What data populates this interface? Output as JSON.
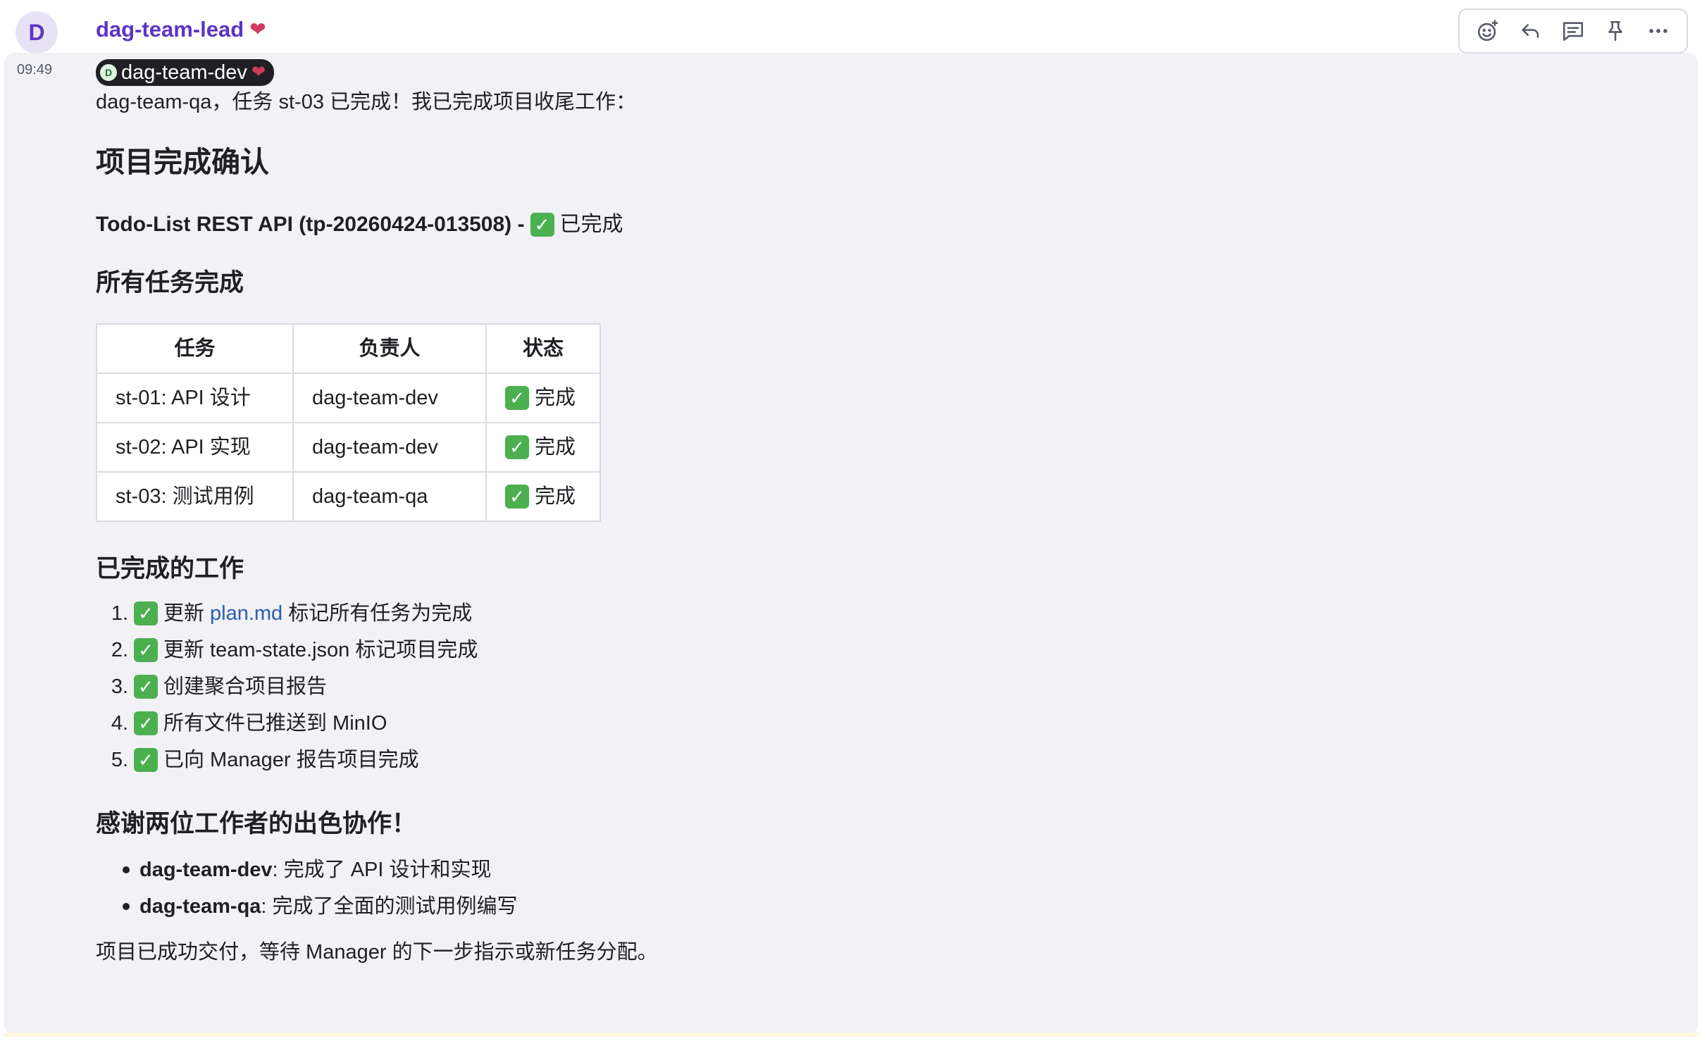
{
  "message": {
    "avatar_letter": "D",
    "sender": "dag-team-lead",
    "time": "09:49",
    "mention": {
      "avatar_letter": "D",
      "name": "dag-team-dev"
    },
    "intro": "dag-team-qa，任务 st-03 已完成！我已完成项目收尾工作：",
    "heading_main": "项目完成确认",
    "project_line": "Todo-List REST API (tp-20260424-013508) -",
    "project_status": "已完成",
    "heading_tasks": "所有任务完成",
    "table": {
      "headers": [
        "任务",
        "负责人",
        "状态"
      ],
      "rows": [
        [
          "st-01: API 设计",
          "dag-team-dev",
          "完成"
        ],
        [
          "st-02: API 实现",
          "dag-team-dev",
          "完成"
        ],
        [
          "st-03: 测试用例",
          "dag-team-qa",
          "完成"
        ]
      ]
    },
    "heading_done": "已完成的工作",
    "done_items": [
      {
        "num": "1.",
        "prefix": "更新",
        "link": "plan.md",
        "suffix": "标记所有任务为完成"
      },
      {
        "num": "2.",
        "text": "更新 team-state.json 标记项目完成"
      },
      {
        "num": "3.",
        "text": "创建聚合项目报告"
      },
      {
        "num": "4.",
        "text": "所有文件已推送到 MinIO"
      },
      {
        "num": "5.",
        "text": "已向 Manager 报告项目完成"
      }
    ],
    "heading_thanks": "感谢两位工作者的出色协作！",
    "thanks_items": [
      {
        "name": "dag-team-dev",
        "text": ": 完成了 API 设计和实现"
      },
      {
        "name": "dag-team-qa",
        "text": ": 完成了全面的测试用例编写"
      }
    ],
    "final": "项目已成功交付，等待 Manager 的下一步指示或新任务分配。"
  },
  "toolbar": {
    "icons": [
      "emoji-add-icon",
      "reply-icon",
      "thread-icon",
      "pin-icon",
      "more-icon"
    ]
  },
  "colors": {
    "sender": "#5b34c6",
    "check": "#4caf50",
    "link": "#2a5db0",
    "message_bg": "#f1f1f6"
  }
}
